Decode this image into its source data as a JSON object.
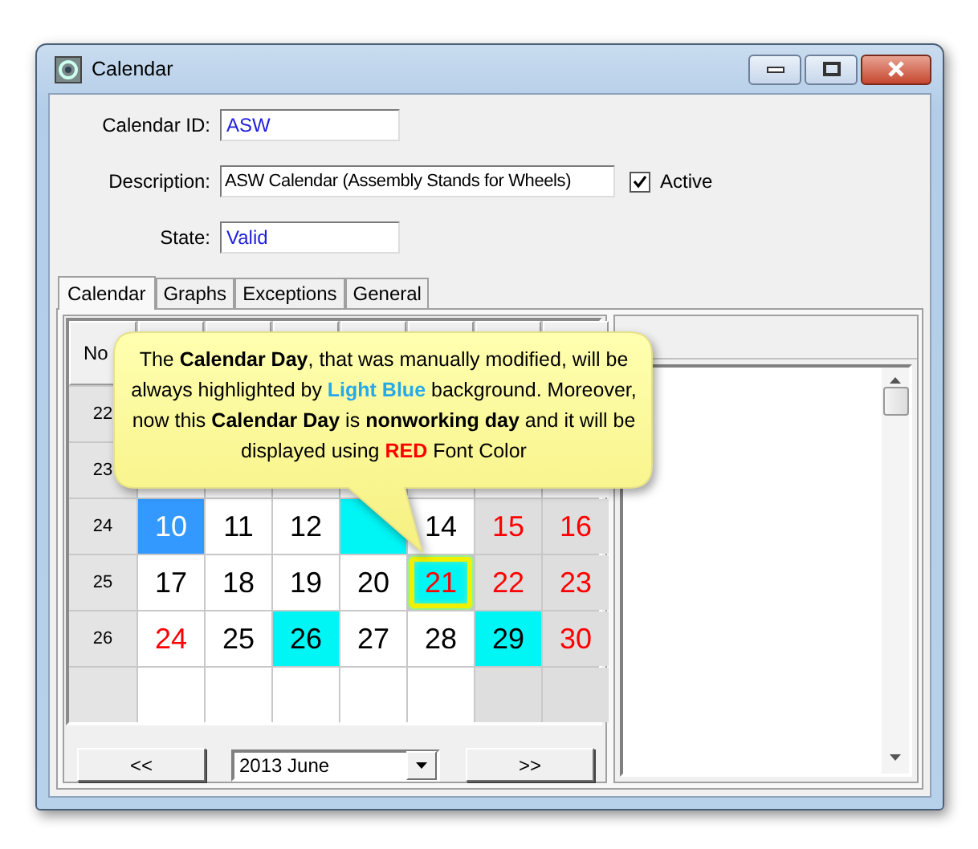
{
  "window": {
    "title": "Calendar"
  },
  "form": {
    "calendar_id": {
      "label": "Calendar ID:",
      "value": "ASW"
    },
    "description": {
      "label": "Description:",
      "value": "ASW Calendar (Assembly Stands for Wheels)"
    },
    "active": {
      "label": "Active",
      "checked": true
    },
    "state": {
      "label": "State:",
      "value": "Valid"
    }
  },
  "tabs": [
    {
      "label": "Calendar",
      "selected": true
    },
    {
      "label": "Graphs",
      "selected": false
    },
    {
      "label": "Exceptions",
      "selected": false
    },
    {
      "label": "General",
      "selected": false
    }
  ],
  "calendar": {
    "week_header": "No",
    "rows": [
      {
        "week": "22"
      },
      {
        "week": "23"
      },
      {
        "week": "24",
        "cells": [
          {
            "text": "10",
            "selected": true,
            "modified": false
          },
          {
            "text": "11",
            "red": false,
            "weekend": false,
            "selected": false,
            "modified": false
          },
          {
            "text": "12",
            "red": false,
            "weekend": false,
            "selected": false,
            "modified": false
          },
          {
            "selected": false,
            "modified": true
          },
          {
            "text": "14",
            "red": false,
            "weekend": false,
            "selected": false,
            "modified": false
          },
          {
            "text": "15",
            "red": true,
            "weekend": true,
            "selected": false,
            "modified": false
          },
          {
            "text": "16",
            "red": true,
            "weekend": true,
            "selected": false,
            "modified": false
          }
        ]
      },
      {
        "week": "25",
        "cells": [
          {
            "text": "17",
            "red": false,
            "weekend": false,
            "selected": false,
            "modified": false
          },
          {
            "text": "18",
            "red": false,
            "weekend": false,
            "selected": false,
            "modified": false
          },
          {
            "text": "19",
            "red": false,
            "weekend": false,
            "selected": false,
            "modified": false
          },
          {
            "text": "20",
            "red": false,
            "weekend": false,
            "selected": false,
            "modified": false
          },
          {
            "text": "21",
            "red": true,
            "selected": false,
            "modified": true,
            "focused": true
          },
          {
            "text": "22",
            "red": true,
            "weekend": true,
            "selected": false,
            "modified": false
          },
          {
            "text": "23",
            "red": true,
            "weekend": true,
            "selected": false,
            "modified": false
          }
        ]
      },
      {
        "week": "26",
        "cells": [
          {
            "text": "24",
            "red": true,
            "weekend": false,
            "selected": false,
            "modified": false
          },
          {
            "text": "25",
            "red": false,
            "weekend": false,
            "selected": false,
            "modified": false
          },
          {
            "text": "26",
            "red": false,
            "selected": false,
            "modified": true
          },
          {
            "text": "27",
            "red": false,
            "weekend": false,
            "selected": false,
            "modified": false
          },
          {
            "text": "28",
            "red": false,
            "weekend": false,
            "selected": false,
            "modified": false
          },
          {
            "text": "29",
            "red": false,
            "selected": false,
            "modified": true
          },
          {
            "text": "30",
            "red": true,
            "weekend": true,
            "selected": false,
            "modified": false
          }
        ]
      },
      {
        "cells": [
          {
            "weekend": false
          },
          {
            "weekend": false
          },
          {
            "weekend": false
          },
          {
            "weekend": false
          },
          {
            "weekend": false
          },
          {
            "weekend": true
          },
          {
            "weekend": true
          }
        ]
      }
    ],
    "prev_button": "<<",
    "month": "2013 June",
    "next_button": ">>"
  },
  "callout": {
    "segments": [
      {
        "text": "The ",
        "kind": "plain"
      },
      {
        "text": "Calendar Day",
        "kind": "bold"
      },
      {
        "text": ", that was manually modified, will be always highlighted by ",
        "kind": "plain"
      },
      {
        "text": "Light Blue",
        "kind": "blue"
      },
      {
        "text": " background.  Moreover, now this ",
        "kind": "plain"
      },
      {
        "text": "Calendar Day",
        "kind": "bold"
      },
      {
        "text": " is ",
        "kind": "plain"
      },
      {
        "text": "nonworking day",
        "kind": "bold"
      },
      {
        "text": " and it will be displayed using ",
        "kind": "plain"
      },
      {
        "text": "RED",
        "kind": "red"
      },
      {
        "text": " Font Color",
        "kind": "plain"
      }
    ]
  }
}
